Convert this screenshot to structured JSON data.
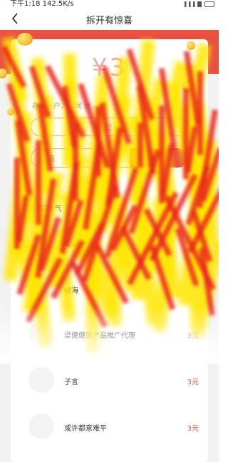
{
  "status_bar": {
    "time_text": "下午1:18",
    "speed_text": "142.5K/s"
  },
  "nav": {
    "title": "拆开有惊喜"
  },
  "card": {
    "amount": "¥3",
    "hint": "存入一户，时间   处，  拆",
    "video_button": "看  红  信",
    "invite_placeholder": "邀  亳",
    "invite_button": "  添"
  },
  "list": {
    "header": "看  家的  气",
    "records": [
      {
        "name": "江湖赴",
        "amount": "3"
      },
      {
        "name": "椒海",
        "amount": "3"
      },
      {
        "name": "梁健健康产品推广代理",
        "amount": "3元"
      },
      {
        "name": "子言",
        "amount": "3元"
      },
      {
        "name": "或许都意难平",
        "amount": "3元"
      }
    ]
  },
  "colors": {
    "accent": "#e8513f",
    "overlay_red": "#e8221a",
    "overlay_yellow": "#ffe600"
  }
}
